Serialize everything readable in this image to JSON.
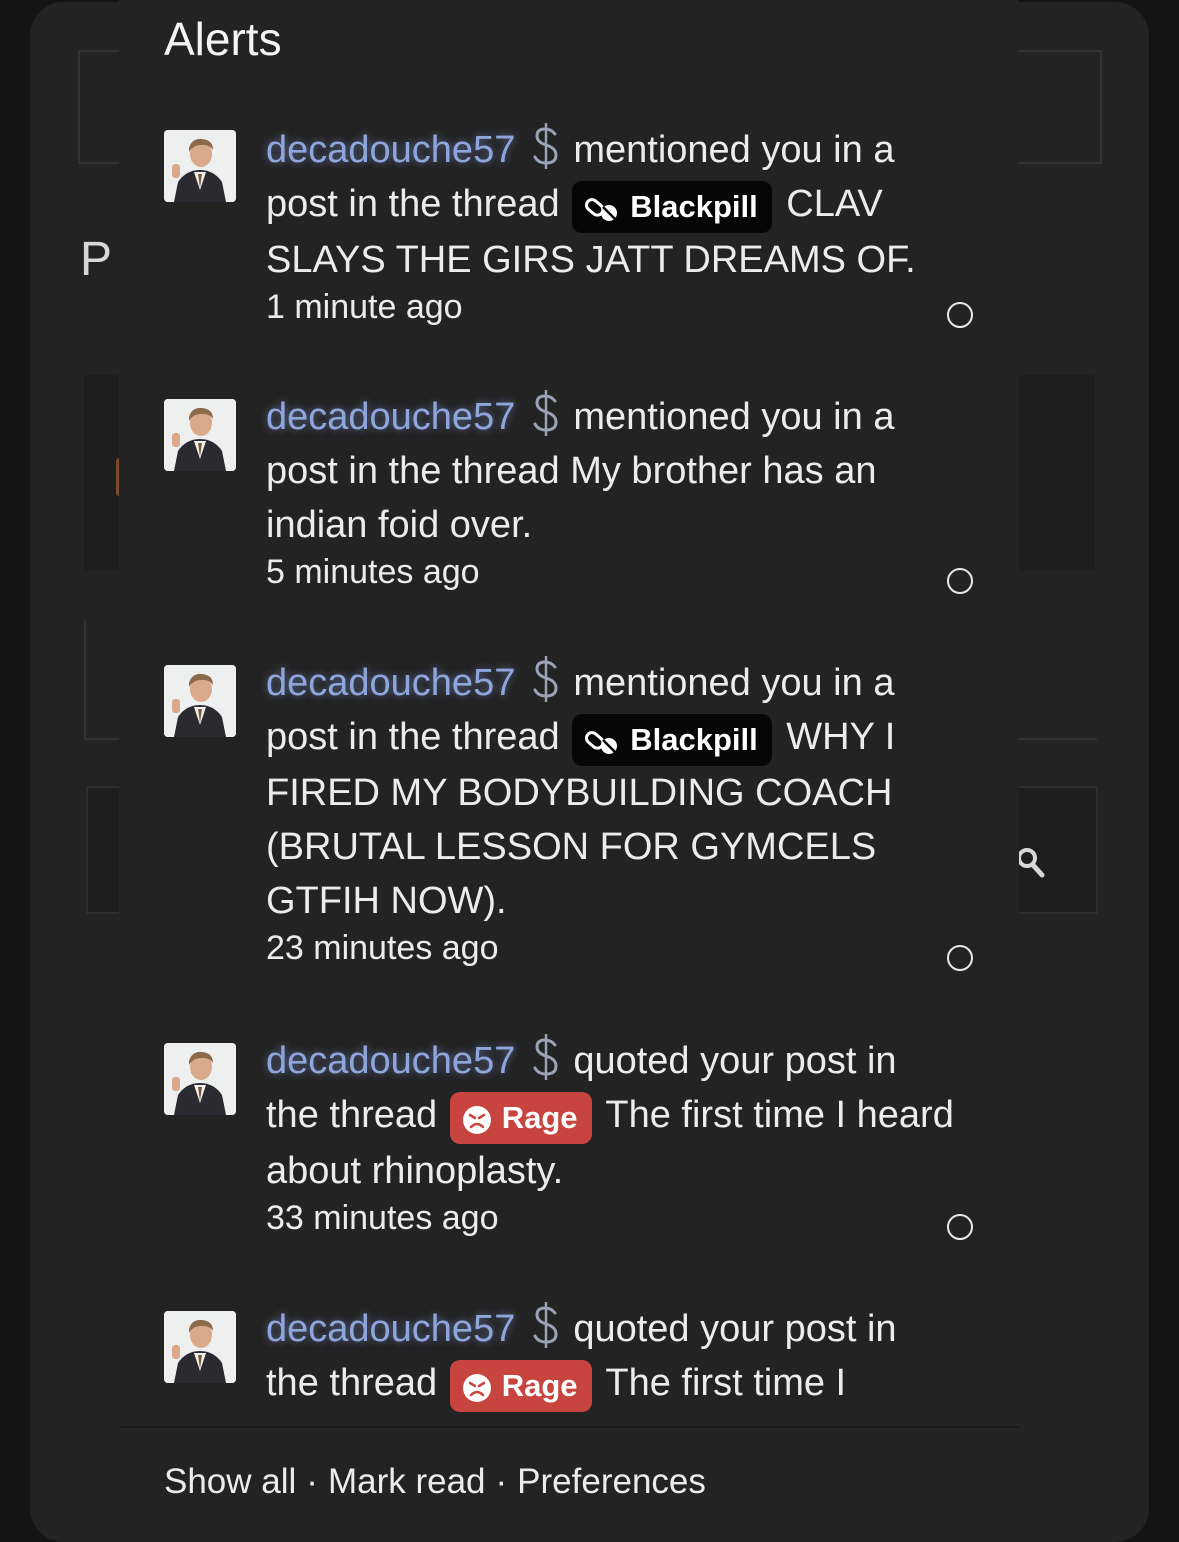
{
  "background": {
    "heading_fragment": "P"
  },
  "alerts": {
    "title": "Alerts",
    "items": [
      {
        "username": "decadouche57",
        "action": "mentioned you in a post in the thread",
        "prefix": "Blackpill",
        "prefix_style": "black",
        "thread": "CLAV SLAYS THE GIRS JATT DREAMS OF.",
        "time": "1 minute ago"
      },
      {
        "username": "decadouche57",
        "action": "mentioned you in a post in the thread",
        "prefix": "",
        "prefix_style": "",
        "thread": "My brother has an indian foid over.",
        "time": "5 minutes ago"
      },
      {
        "username": "decadouche57",
        "action": "mentioned you in a post in the thread",
        "prefix": "Blackpill",
        "prefix_style": "black",
        "thread": "WHY I FIRED MY BODYBUILDING COACH (BRUTAL LESSON FOR GYMCELS GTFIH NOW).",
        "time": "23 minutes ago"
      },
      {
        "username": "decadouche57",
        "action": "quoted your post in the thread",
        "prefix": "Rage",
        "prefix_style": "red",
        "thread": "The first time I heard about rhinoplasty.",
        "time": "33 minutes ago"
      },
      {
        "username": "decadouche57",
        "action": "quoted your post in the thread",
        "prefix": "Rage",
        "prefix_style": "red",
        "thread": "The first time I",
        "time": ""
      }
    ],
    "footer": {
      "show_all": "Show all",
      "mark_read": "Mark read",
      "preferences": "Preferences",
      "separator": "·"
    }
  },
  "colors": {
    "popup_bg": "#232323",
    "username": "#8fa6dc",
    "blackpill_bg": "#060606",
    "rage_bg": "#c8453f"
  },
  "icons": {
    "badge": "dollar-sign-icon",
    "blackpill": "pills-icon",
    "rage": "angry-face-icon",
    "unread": "circle-outline-icon",
    "search": "search-icon"
  }
}
